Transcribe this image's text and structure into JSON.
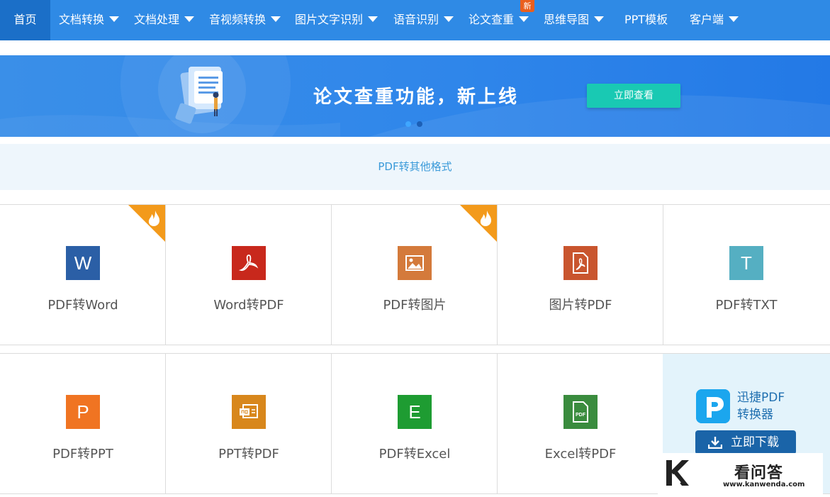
{
  "nav": {
    "items": [
      {
        "label": "首页",
        "active": true,
        "dropdown": false
      },
      {
        "label": "文档转换",
        "active": false,
        "dropdown": true
      },
      {
        "label": "文档处理",
        "active": false,
        "dropdown": true
      },
      {
        "label": "音视频转换",
        "active": false,
        "dropdown": true
      },
      {
        "label": "图片文字识别",
        "active": false,
        "dropdown": true
      },
      {
        "label": "语音识别",
        "active": false,
        "dropdown": true
      },
      {
        "label": "论文查重",
        "active": false,
        "dropdown": true,
        "badge": "新"
      },
      {
        "label": "思维导图",
        "active": false,
        "dropdown": true
      },
      {
        "label": "PPT模板",
        "active": false,
        "dropdown": false
      },
      {
        "label": "客户端",
        "active": false,
        "dropdown": true
      }
    ]
  },
  "banner": {
    "title": "论文查重功能，新上线",
    "button": "立即查看",
    "slides": 2,
    "active_slide": 1
  },
  "section": {
    "title": "PDF转其他格式"
  },
  "tools": {
    "row1": [
      {
        "label": "PDF转Word",
        "icon": "word-icon",
        "glyph": "W",
        "color": "#2b5fa6",
        "hot": true
      },
      {
        "label": "Word转PDF",
        "icon": "acrobat-icon",
        "glyph": "",
        "color": "#c8281c",
        "hot": false
      },
      {
        "label": "PDF转图片",
        "icon": "image-icon",
        "glyph": "",
        "color": "#d47a3b",
        "hot": true
      },
      {
        "label": "图片转PDF",
        "icon": "pdf-doc-icon",
        "glyph": "",
        "color": "#c9552e",
        "hot": false
      },
      {
        "label": "PDF转TXT",
        "icon": "txt-icon",
        "glyph": "T",
        "color": "#55afc2",
        "hot": false
      }
    ],
    "row2": [
      {
        "label": "PDF转PPT",
        "icon": "ppt-icon",
        "glyph": "P",
        "color": "#f07422",
        "hot": false
      },
      {
        "label": "PPT转PDF",
        "icon": "ppt-pdf-icon",
        "glyph": "",
        "color": "#d8871c",
        "hot": false
      },
      {
        "label": "PDF转Excel",
        "icon": "excel-icon",
        "glyph": "E",
        "color": "#1e9c32",
        "hot": false
      },
      {
        "label": "Excel转PDF",
        "icon": "excel-pdf-icon",
        "glyph": "",
        "color": "#3a8c3e",
        "hot": false
      }
    ]
  },
  "promo": {
    "title_line1": "迅捷PDF",
    "title_line2": "转换器",
    "button": "立即下载"
  },
  "watermark": {
    "name": "看问答",
    "url": "www.kanwenda.com"
  }
}
